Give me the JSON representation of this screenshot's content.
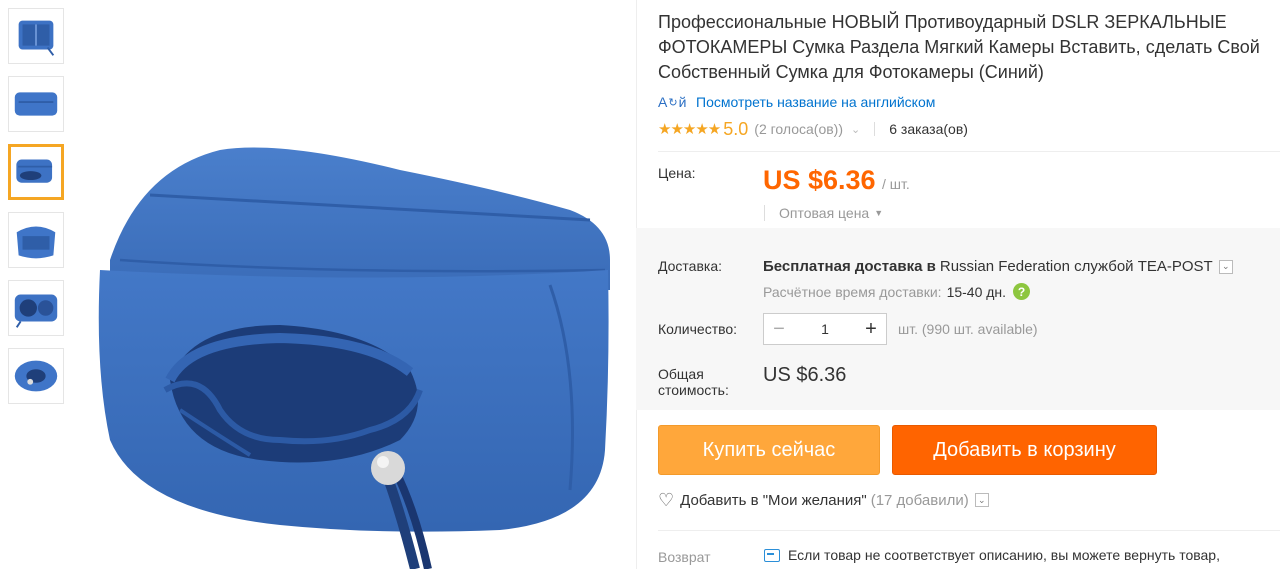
{
  "product": {
    "title": "Профессиональные НОВЫЙ Противоударный DSLR ЗЕРКАЛЬНЫЕ ФОТОКАМЕРЫ Сумка Раздела Мягкий Камеры Вставить, сделать Свой Собственный Сумка для Фотокамеры (Синий)",
    "translate_link": "Посмотреть название на английском",
    "translate_icon": "translate-icon"
  },
  "rating": {
    "stars": "★★★★★",
    "value": "5.0",
    "votes": "(2 голоса(ов))",
    "orders": "6 заказа(ов)"
  },
  "price": {
    "label": "Цена:",
    "value": "US $6.36",
    "per_unit": "/ шт.",
    "wholesale": "Оптовая цена"
  },
  "shipping": {
    "label": "Доставка:",
    "free": "Бесплатная доставка в",
    "destination": "Russian Federation службой TEA-POST",
    "time_label": "Расчётное время доставки:",
    "time_value": "15-40 дн."
  },
  "quantity": {
    "label": "Количество:",
    "value": "1",
    "available": "шт. (990 шт. available)"
  },
  "total": {
    "label": "Общая стоимость:",
    "value": "US $6.36"
  },
  "actions": {
    "buy_now": "Купить сейчас",
    "add_to_cart": "Добавить в корзину",
    "wishlist": "Добавить в \"Мои желания\"",
    "wishlist_count": "(17 добавили)"
  },
  "returns": {
    "label": "Возврат",
    "text": "Если товар не соответствует описанию, вы можете вернуть товар,"
  },
  "colors": {
    "accent_orange": "#ff6600",
    "buy_button": "#ffa73b",
    "cart_button": "#ff6400",
    "link_blue": "#0073cf",
    "star": "#f5a623",
    "product_blue": "#3a6fc0"
  }
}
